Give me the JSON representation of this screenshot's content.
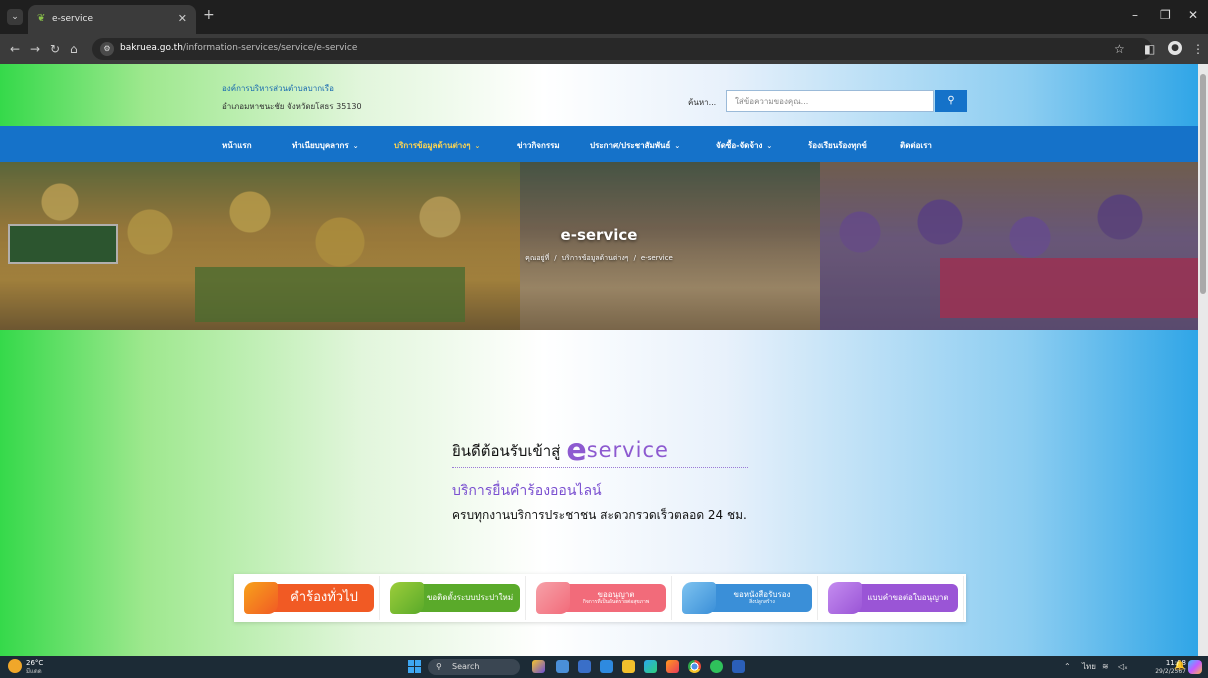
{
  "browser": {
    "tab_title": "e-service",
    "url_host": "bakruea.go.th",
    "url_path": "/information-services/service/e-service"
  },
  "header": {
    "org_name": "องค์การบริหารส่วนตำบลบากเรือ",
    "org_address": "อำเภอมหาชนะชัย จังหวัดยโสธร 35130",
    "search_label": "ค้นหา...",
    "search_placeholder": "ใส่ข้อความของคุณ..."
  },
  "nav": [
    {
      "label": "หน้าแรก",
      "has_caret": false,
      "active": false
    },
    {
      "label": "ทำเนียบบุคลากร",
      "has_caret": true,
      "active": false
    },
    {
      "label": "บริการข้อมูลด้านต่างๆ",
      "has_caret": true,
      "active": true
    },
    {
      "label": "ข่าวกิจกรรม",
      "has_caret": false,
      "active": false
    },
    {
      "label": "ประกาศ/ประชาสัมพันธ์",
      "has_caret": true,
      "active": false
    },
    {
      "label": "จัดซื้อ-จัดจ้าง",
      "has_caret": true,
      "active": false
    },
    {
      "label": "ร้องเรียนร้องทุกข์",
      "has_caret": false,
      "active": false
    },
    {
      "label": "ติดต่อเรา",
      "has_caret": false,
      "active": false
    }
  ],
  "banner": {
    "title": "e-service",
    "breadcrumb": [
      "คุณอยู่ที่",
      "บริการข้อมูลด้านต่างๆ",
      "e-service"
    ]
  },
  "welcome": {
    "lead": "ยินดีต้อนรับเข้าสู่",
    "logo_e": "e",
    "logo_rest": "service",
    "subtitle": "บริการยื่นคำร้องออนไลน์",
    "tagline": "ครบทุกงานบริการประชาชน  สะดวกรวดเร็วตลอด 24 ชม."
  },
  "services": [
    {
      "line1": "คำร้องทั่วไป",
      "line2": "",
      "color": "#f15a24",
      "accent": "#f7a21b"
    },
    {
      "line1": "ขอติดตั้งระบบประปาใหม่",
      "line2": "",
      "color": "#5aaa2a",
      "accent": "#9ccd3a"
    },
    {
      "line1": "ขออนุญาต",
      "line2": "กิจการที่เป็นอันตรายต่อสุขภาพ",
      "color": "#f26b7a",
      "accent": "#f6a1a8"
    },
    {
      "line1": "ขอหนังสือรับรอง",
      "line2": "สิ่งปลูกสร้าง",
      "color": "#3a8fd8",
      "accent": "#7ec3f0"
    },
    {
      "line1": "แบบคำขอต่อใบอนุญาต",
      "line2": "",
      "color": "#9a55d6",
      "accent": "#c48cf0"
    }
  ],
  "taskbar": {
    "temperature": "26°C",
    "weather": "มีแดด",
    "search": "Search",
    "lang": "ไทย",
    "time": "11:08",
    "date": "29/2/2567"
  }
}
